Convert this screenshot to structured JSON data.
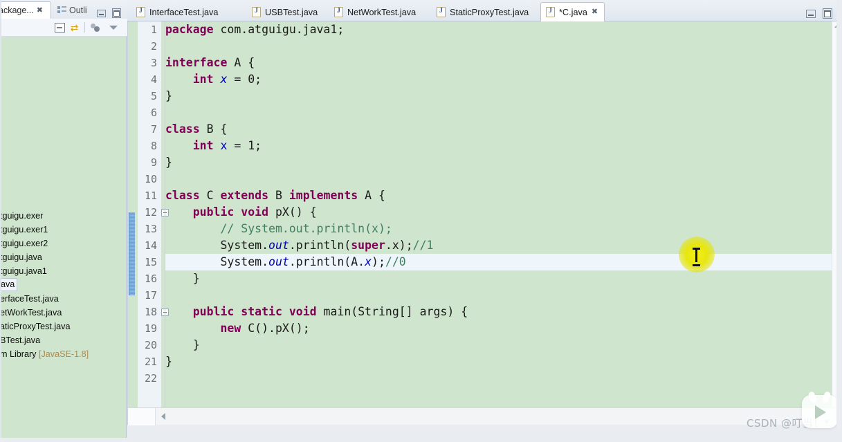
{
  "window": {
    "minimize_label": "Minimize",
    "maximize_label": "Maximize"
  },
  "left_panel": {
    "tabs": [
      {
        "label": "ackage...",
        "icon": "close-icon",
        "active": true
      },
      {
        "label": "Outli",
        "icon": "outline-icon",
        "active": false
      }
    ],
    "toolbar": [
      {
        "name": "collapse-all-icon",
        "label": "Collapse All"
      },
      {
        "name": "link-with-editor-icon",
        "label": "Link with Editor"
      },
      {
        "name": "focus-on-active-task-icon",
        "label": "Focus on Active Task"
      },
      {
        "name": "view-menu-icon",
        "label": "View Menu"
      }
    ],
    "tree": [
      {
        "label": "tguigu.exer",
        "suffix": "",
        "selected": false
      },
      {
        "label": "tguigu.exer1",
        "suffix": "",
        "selected": false
      },
      {
        "label": "tguigu.exer2",
        "suffix": "",
        "selected": false
      },
      {
        "label": "tguigu.java",
        "suffix": "",
        "selected": false
      },
      {
        "label": "tguigu.java1",
        "suffix": "",
        "selected": false
      },
      {
        "label": "ava",
        "suffix": "",
        "selected": true
      },
      {
        "label": "erfaceTest.java",
        "suffix": "",
        "selected": false
      },
      {
        "label": "etWorkTest.java",
        "suffix": "",
        "selected": false
      },
      {
        "label": "aticProxyTest.java",
        "suffix": "",
        "selected": false
      },
      {
        "label": "BTest.java",
        "suffix": "",
        "selected": false
      },
      {
        "label": "m Library",
        "suffix": "[JavaSE-1.8]",
        "selected": false
      }
    ]
  },
  "editor": {
    "tabs": [
      {
        "label": "InterfaceTest.java",
        "active": false,
        "dirty": false
      },
      {
        "label": "USBTest.java",
        "active": false,
        "dirty": false
      },
      {
        "label": "NetWorkTest.java",
        "active": false,
        "dirty": false
      },
      {
        "label": "StaticProxyTest.java",
        "active": false,
        "dirty": false
      },
      {
        "label": "*C.java",
        "active": true,
        "dirty": true
      }
    ],
    "line_numbers": [
      "1",
      "2",
      "3",
      "4",
      "5",
      "6",
      "7",
      "8",
      "9",
      "10",
      "11",
      "12",
      "13",
      "14",
      "15",
      "16",
      "17",
      "18",
      "19",
      "20",
      "21",
      "22"
    ],
    "fold_markers": [
      12,
      18
    ],
    "change_bar_lines": [
      12,
      13,
      14,
      15,
      16
    ],
    "current_line": 15,
    "code_lines": [
      {
        "n": 1,
        "tokens": [
          {
            "t": "package",
            "c": "kw"
          },
          {
            "t": " com.atguigu.java1;",
            "c": "plain"
          }
        ]
      },
      {
        "n": 2,
        "tokens": []
      },
      {
        "n": 3,
        "tokens": [
          {
            "t": "interface",
            "c": "kw"
          },
          {
            "t": " A {",
            "c": "plain"
          }
        ]
      },
      {
        "n": 4,
        "tokens": [
          {
            "t": "    ",
            "c": "plain"
          },
          {
            "t": "int",
            "c": "kw"
          },
          {
            "t": " ",
            "c": "plain"
          },
          {
            "t": "x",
            "c": "fldi"
          },
          {
            "t": " = 0;",
            "c": "plain"
          }
        ]
      },
      {
        "n": 5,
        "tokens": [
          {
            "t": "}",
            "c": "plain"
          }
        ]
      },
      {
        "n": 6,
        "tokens": []
      },
      {
        "n": 7,
        "tokens": [
          {
            "t": "class",
            "c": "kw"
          },
          {
            "t": " B {",
            "c": "plain"
          }
        ]
      },
      {
        "n": 8,
        "tokens": [
          {
            "t": "    ",
            "c": "plain"
          },
          {
            "t": "int",
            "c": "kw"
          },
          {
            "t": " ",
            "c": "plain"
          },
          {
            "t": "x",
            "c": "fld"
          },
          {
            "t": " = 1;",
            "c": "plain"
          }
        ]
      },
      {
        "n": 9,
        "tokens": [
          {
            "t": "}",
            "c": "plain"
          }
        ]
      },
      {
        "n": 10,
        "tokens": []
      },
      {
        "n": 11,
        "tokens": [
          {
            "t": "class",
            "c": "kw"
          },
          {
            "t": " C ",
            "c": "plain"
          },
          {
            "t": "extends",
            "c": "kw"
          },
          {
            "t": " B ",
            "c": "plain"
          },
          {
            "t": "implements",
            "c": "kw"
          },
          {
            "t": " A {",
            "c": "plain"
          }
        ]
      },
      {
        "n": 12,
        "tokens": [
          {
            "t": "    ",
            "c": "plain"
          },
          {
            "t": "public",
            "c": "kw"
          },
          {
            "t": " ",
            "c": "plain"
          },
          {
            "t": "void",
            "c": "kw"
          },
          {
            "t": " pX() {",
            "c": "plain"
          }
        ]
      },
      {
        "n": 13,
        "tokens": [
          {
            "t": "        // System.out.println(x);",
            "c": "cmt"
          }
        ]
      },
      {
        "n": 14,
        "tokens": [
          {
            "t": "        System.",
            "c": "plain"
          },
          {
            "t": "out",
            "c": "fldi"
          },
          {
            "t": ".println(",
            "c": "plain"
          },
          {
            "t": "super",
            "c": "kw"
          },
          {
            "t": ".x);",
            "c": "plain"
          },
          {
            "t": "//1",
            "c": "cmt"
          }
        ]
      },
      {
        "n": 15,
        "tokens": [
          {
            "t": "        System.",
            "c": "plain"
          },
          {
            "t": "out",
            "c": "fldi"
          },
          {
            "t": ".println(A.",
            "c": "plain"
          },
          {
            "t": "x",
            "c": "fldi"
          },
          {
            "t": ");",
            "c": "plain"
          },
          {
            "t": "//0",
            "c": "cmt"
          }
        ]
      },
      {
        "n": 16,
        "tokens": [
          {
            "t": "    }",
            "c": "plain"
          }
        ]
      },
      {
        "n": 17,
        "tokens": []
      },
      {
        "n": 18,
        "tokens": [
          {
            "t": "    ",
            "c": "plain"
          },
          {
            "t": "public",
            "c": "kw"
          },
          {
            "t": " ",
            "c": "plain"
          },
          {
            "t": "static",
            "c": "kw"
          },
          {
            "t": " ",
            "c": "plain"
          },
          {
            "t": "void",
            "c": "kw"
          },
          {
            "t": " main(String[] args) {",
            "c": "plain"
          }
        ]
      },
      {
        "n": 19,
        "tokens": [
          {
            "t": "        ",
            "c": "plain"
          },
          {
            "t": "new",
            "c": "kw"
          },
          {
            "t": " C().pX();",
            "c": "plain"
          }
        ]
      },
      {
        "n": 20,
        "tokens": [
          {
            "t": "    }",
            "c": "plain"
          }
        ]
      },
      {
        "n": 21,
        "tokens": [
          {
            "t": "}",
            "c": "plain"
          }
        ]
      },
      {
        "n": 22,
        "tokens": []
      }
    ]
  },
  "overlay": {
    "watermark": "CSDN @叮当！*",
    "cursor_type": "text-ibeam"
  },
  "colors": {
    "editor_background": "#cfe5cd",
    "keyword": "#7f0055",
    "field": "#0000c0",
    "comment": "#3f7f5f",
    "current_line": "#eef5fb",
    "change_bar": "#6f9fcf",
    "cursor_glow": "#e8e610"
  }
}
